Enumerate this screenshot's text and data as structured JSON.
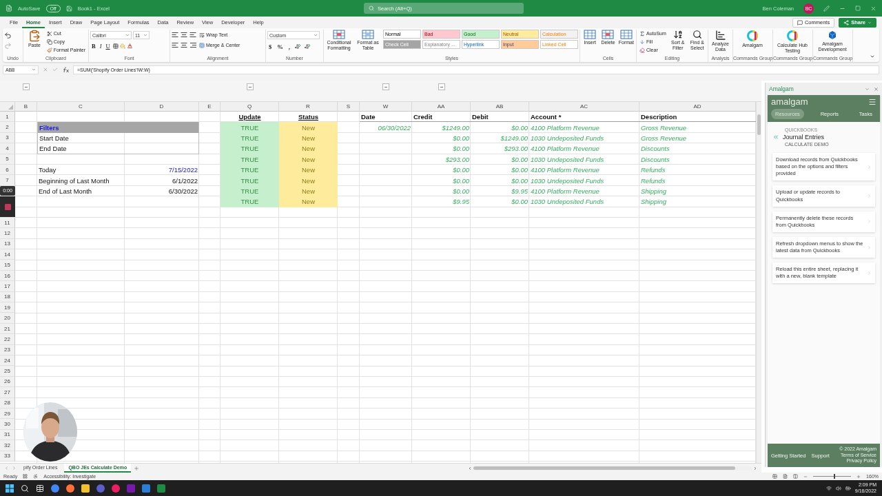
{
  "title_bar": {
    "autosave": "AutoSave",
    "autosave_toggle": {
      "label": "Off",
      "on": false
    },
    "document": "Book1  -  Excel",
    "search": {
      "placeholder": "Search (Alt+Q)"
    },
    "user": "Ben Coleman",
    "avatar": "BC"
  },
  "menu": {
    "tabs": [
      {
        "label": "File",
        "selected": false
      },
      {
        "label": "Home",
        "selected": true
      },
      {
        "label": "Insert",
        "selected": false
      },
      {
        "label": "Draw",
        "selected": false
      },
      {
        "label": "Page Layout",
        "selected": false
      },
      {
        "label": "Formulas",
        "selected": false
      },
      {
        "label": "Data",
        "selected": false
      },
      {
        "label": "Review",
        "selected": false
      },
      {
        "label": "View",
        "selected": false
      },
      {
        "label": "Developer",
        "selected": false
      },
      {
        "label": "Help",
        "selected": false
      }
    ],
    "comments": "Comments",
    "share": "Share"
  },
  "ribbon": {
    "groups": [
      {
        "kind": "undo",
        "label": "Undo"
      },
      {
        "kind": "clipboard",
        "label": "Clipboard",
        "paste": "Paste",
        "items": [
          "Cut",
          "Copy",
          "Format Painter"
        ]
      },
      {
        "kind": "font",
        "label": "Font",
        "font": "Calibri",
        "size": "11",
        "styles": [
          "B",
          "I",
          "U"
        ]
      },
      {
        "kind": "alignment",
        "label": "Alignment",
        "items": [
          "Wrap Text",
          "Merge & Center"
        ]
      },
      {
        "kind": "number",
        "label": "Number",
        "format": "Custom",
        "symbols": [
          "$",
          "%",
          ","
        ]
      },
      {
        "kind": "styles",
        "label": "Styles",
        "buttons": [
          "Conditional Formatting",
          "Format as Table"
        ],
        "cells": [
          {
            "label": "Normal",
            "color": "#ffffff"
          },
          {
            "label": "Check Cell",
            "color": "#a5a5a5"
          },
          {
            "label": "Bad",
            "color": "#ffc7ce"
          },
          {
            "label": "Explanatory ...",
            "color": "#ffffff"
          },
          {
            "label": "Good",
            "color": "#c6efce"
          },
          {
            "label": "Hyperlink",
            "color": "#ffffff"
          },
          {
            "label": "Neutral",
            "color": "#ffeb9c"
          },
          {
            "label": "Input",
            "color": "#ffcc99"
          },
          {
            "label": "Calculation",
            "color": "#f2f2f2"
          },
          {
            "label": "Linked Cell",
            "color": "#ffffff"
          }
        ]
      },
      {
        "kind": "cells",
        "label": "Cells",
        "buttons": [
          "Insert",
          "Delete",
          "Format"
        ]
      },
      {
        "kind": "editing",
        "label": "Editing",
        "items": [
          "AutoSum",
          "Fill",
          "Clear"
        ],
        "buttons": [
          "Sort & Filter",
          "Find & Select"
        ]
      },
      {
        "kind": "analysis",
        "label": "Analysis",
        "buttons": [
          "Analyze Data"
        ]
      },
      {
        "kind": "addin",
        "label": "Commands Group",
        "buttons": [
          "Amalgam"
        ]
      },
      {
        "kind": "addin",
        "label": "Commands Group",
        "buttons": [
          "Calculate Hub Testing"
        ]
      },
      {
        "kind": "addin",
        "label": "Commands Group",
        "buttons": [
          "Amalgam Development"
        ]
      }
    ]
  },
  "formula_bar": {
    "cell": "AB8",
    "formula": "=SUM('Shopify Order Lines'!W:W)"
  },
  "sheet": {
    "columns": [
      "B",
      "C",
      "D",
      "E",
      "Q",
      "R",
      "S",
      "W",
      "AA",
      "AB",
      "AC",
      "AD"
    ],
    "row_headers": [
      {
        "kind": "number",
        "text": "1"
      },
      {
        "kind": "number",
        "text": "2"
      },
      {
        "kind": "number",
        "text": "3"
      },
      {
        "kind": "number",
        "text": "4"
      },
      {
        "kind": "number",
        "text": "5"
      },
      {
        "kind": "number",
        "text": "6"
      },
      {
        "kind": "number",
        "text": "7"
      },
      {
        "kind": "timer",
        "text": "0:00"
      },
      {
        "kind": "stop"
      },
      {
        "kind": "covered"
      },
      {
        "kind": "number",
        "text": "11"
      },
      {
        "kind": "number",
        "text": "12"
      },
      {
        "kind": "number",
        "text": "13"
      },
      {
        "kind": "number",
        "text": "14"
      },
      {
        "kind": "number",
        "text": "15"
      },
      {
        "kind": "number",
        "text": "16"
      },
      {
        "kind": "number",
        "text": "17"
      },
      {
        "kind": "number",
        "text": "18"
      },
      {
        "kind": "number",
        "text": "19"
      },
      {
        "kind": "number",
        "text": "20"
      },
      {
        "kind": "number",
        "text": "21"
      },
      {
        "kind": "number",
        "text": "22"
      },
      {
        "kind": "number",
        "text": "23"
      },
      {
        "kind": "number",
        "text": "24"
      },
      {
        "kind": "number",
        "text": "25"
      },
      {
        "kind": "number",
        "text": "26"
      },
      {
        "kind": "number",
        "text": "27"
      },
      {
        "kind": "number",
        "text": "28"
      },
      {
        "kind": "number",
        "text": "29"
      },
      {
        "kind": "number",
        "text": "30"
      },
      {
        "kind": "number",
        "text": "31"
      },
      {
        "kind": "number",
        "text": "32"
      },
      {
        "kind": "number",
        "text": "33"
      }
    ],
    "filters": {
      "title": "Filters",
      "fields": [
        "Start Date",
        "End Date"
      ]
    },
    "dates": [
      {
        "label": "Today",
        "value": "7/15/2022",
        "highlight": true
      },
      {
        "label": "Beginning of Last Month",
        "value": "6/1/2022",
        "highlight": false
      },
      {
        "label": "End of Last Month",
        "value": "6/30/2022",
        "highlight": false
      }
    ],
    "journal": {
      "columns": [
        {
          "label": "Update",
          "kind": "flag"
        },
        {
          "label": "Status",
          "kind": "flag"
        },
        {
          "label": "Date",
          "kind": "field"
        },
        {
          "label": "Credit",
          "kind": "field"
        },
        {
          "label": "Debit",
          "kind": "field"
        },
        {
          "label": "Account *",
          "kind": "field"
        },
        {
          "label": "Description",
          "kind": "field"
        }
      ],
      "rows": [
        {
          "update": "TRUE",
          "status": "New",
          "date": "06/30/2022",
          "credit": "$1249.00",
          "debit": "$0.00",
          "account": "4100 Platform Revenue",
          "description": "Gross Revenue"
        },
        {
          "update": "TRUE",
          "status": "New",
          "credit": "$0.00",
          "debit": "$1249.00",
          "account": "1030 Undeposited Funds",
          "description": "Gross Revenue"
        },
        {
          "update": "TRUE",
          "status": "New",
          "credit": "$0.00",
          "debit": "$293.00",
          "account": "4100 Platform Revenue",
          "description": "Discounts"
        },
        {
          "update": "TRUE",
          "status": "New",
          "credit": "$293.00",
          "debit": "$0.00",
          "account": "1030 Undeposited Funds",
          "description": "Discounts"
        },
        {
          "update": "TRUE",
          "status": "New",
          "credit": "$0.00",
          "debit": "$0.00",
          "account": "4100 Platform Revenue",
          "description": "Refunds"
        },
        {
          "update": "TRUE",
          "status": "New",
          "credit": "$0.00",
          "debit": "$0.00",
          "account": "1030 Undeposited Funds",
          "description": "Refunds"
        },
        {
          "update": "TRUE",
          "status": "New",
          "credit": "$0.00",
          "debit": "$9.95",
          "account": "4100 Platform Revenue",
          "description": "Shipping"
        },
        {
          "update": "TRUE",
          "status": "New",
          "credit": "$9.95",
          "debit": "$0.00",
          "account": "1030 Undeposited Funds",
          "description": "Shipping"
        }
      ]
    },
    "tabs": [
      {
        "label": "pify Order Lines",
        "selected": false
      },
      {
        "label": "QBO JEs Calculate Demo",
        "selected": true
      }
    ]
  },
  "panel": {
    "title": "Amalgam",
    "logo": "amalgam",
    "tabs": [
      {
        "label": "Resources",
        "selected": true
      },
      {
        "label": "Reports",
        "selected": false
      },
      {
        "label": "Tasks",
        "selected": false
      }
    ],
    "breadcrumb": "QUICKBOOKS",
    "heading": "Journal Entries",
    "subheading": "CALCULATE DEMO",
    "actions": [
      "Download records from Quickbooks based on the options and filters provided",
      "Upload or update records to Quickbooks",
      "Permanently delete these records from Quickbooks",
      "Refresh dropdown menus to show the latest data from Quickbooks",
      "Reload this entire sheet, replacing it with a new, blank template"
    ],
    "footer": {
      "links": [
        "Getting Started",
        "Support"
      ],
      "legal": [
        "© 2022 Amalgam",
        "Terms of Service",
        "Privacy Policy"
      ]
    }
  },
  "status_bar": {
    "status": "Ready",
    "accessibility": "Accessibility: Investigate",
    "zoom_slider": {
      "level": 0.55
    },
    "zoom": "160%"
  },
  "taskbar": {
    "time": "2:09 PM",
    "date": "9/16/2022"
  }
}
